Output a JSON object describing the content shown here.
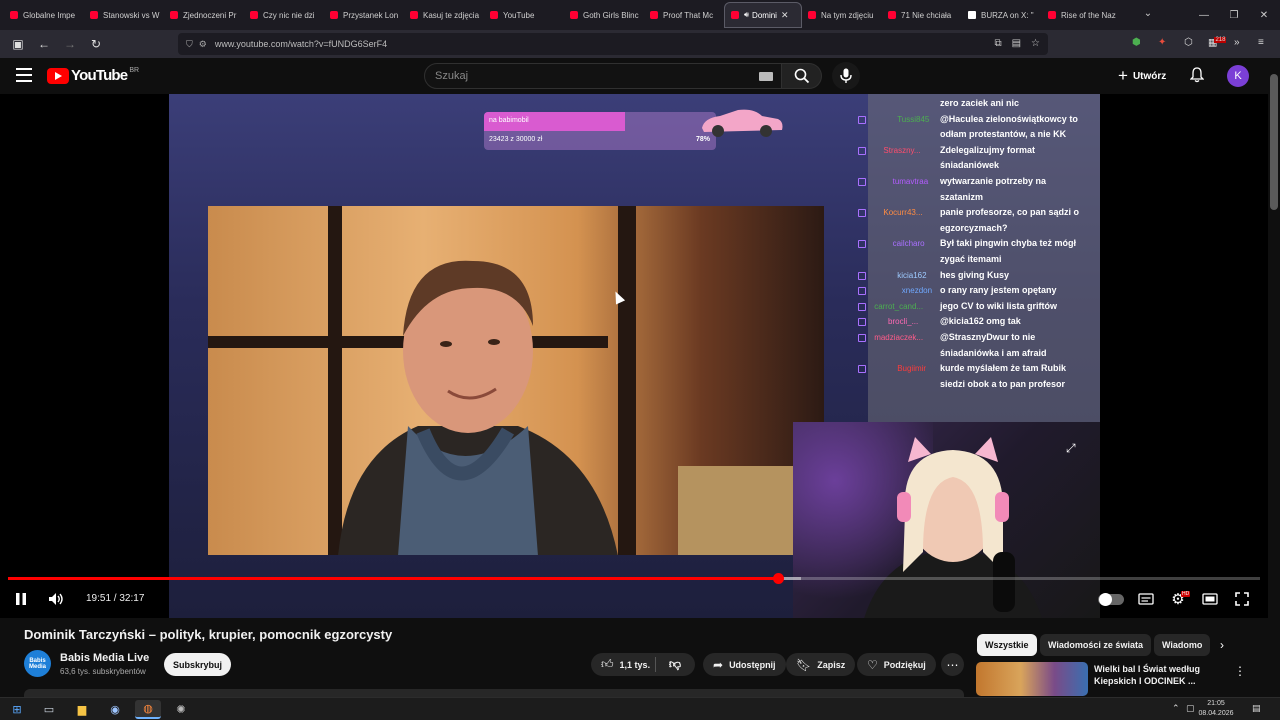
{
  "browser": {
    "tabs": [
      {
        "label": "Globalne Impe",
        "favicon": "youtube-icon"
      },
      {
        "label": "Stanowski vs W",
        "favicon": "youtube-icon"
      },
      {
        "label": "Zjednoczeni Pr",
        "favicon": "youtube-icon"
      },
      {
        "label": "Czy nic nie dzi",
        "favicon": "youtube-icon"
      },
      {
        "label": "Przystanek Lon",
        "favicon": "youtube-icon"
      },
      {
        "label": "Kasuj te zdjęcia",
        "favicon": "youtube-icon"
      },
      {
        "label": "YouTube",
        "favicon": "youtube-icon"
      },
      {
        "label": "Goth Girls Blinc",
        "favicon": "youtube-icon"
      },
      {
        "label": "Proof That Mc",
        "favicon": "youtube-icon"
      },
      {
        "label": "Domini",
        "favicon": "youtube-icon",
        "active": true
      },
      {
        "label": "Na tym zdjęciu",
        "favicon": "youtube-icon"
      },
      {
        "label": "71 Nie chciała",
        "favicon": "youtube-icon"
      },
      {
        "label": "BURZA on X: \"",
        "favicon": "x-icon"
      },
      {
        "label": "Rise of the Naz",
        "favicon": "youtube-icon"
      }
    ],
    "url": "www.youtube.com/watch?v=fUNDG6SerF4",
    "extension_badge": "218"
  },
  "youtube": {
    "logo_text": "YouTube",
    "country_code": "BR",
    "search_placeholder": "Szukaj",
    "create_label": "Utwórz",
    "avatar_letter": "K"
  },
  "video": {
    "title": "Dominik Tarczyński – polityk, krupier, pomocnik egzorcysty",
    "time_current": "19:51",
    "time_total": "32:17",
    "time_display": "19:51 / 32:17",
    "progress_fraction": 0.615,
    "buffer_fraction": 0.633,
    "overlay": {
      "goal_title": "na babimobil",
      "goal_amount": "23423 z 30000 zł",
      "goal_percent": "78%",
      "goal_fraction": 0.78
    },
    "chat": [
      {
        "user": "",
        "text": "zero zaciek ani nic",
        "color": "#4caf50"
      },
      {
        "user": "Tussi845",
        "text": "@Haculea zielonoświątkowcy to",
        "color": "#4caf50"
      },
      {
        "user": "",
        "text": "odłam protestantów, a nie KK",
        "color": "#4caf50"
      },
      {
        "user": "Straszny...",
        "text": "Zdelegalizujmy format",
        "color": "#ff4d6d"
      },
      {
        "user": "",
        "text": "śniadaniówek",
        "color": "#ff4d6d"
      },
      {
        "user": "tumavtraa",
        "text": "wytwarzanie potrzeby na",
        "color": "#b45cff"
      },
      {
        "user": "",
        "text": "szatanizm",
        "color": "#b45cff"
      },
      {
        "user": "Kocurr43...",
        "text": "panie profesorze, co pan sądzi o",
        "color": "#ff8c42"
      },
      {
        "user": "",
        "text": "egzorcyzmach?",
        "color": "#ff8c42"
      },
      {
        "user": "cailcharo",
        "text": "Był taki pingwin chyba też mógł",
        "color": "#a970ff"
      },
      {
        "user": "",
        "text": "zygać itemami",
        "color": "#a970ff"
      },
      {
        "user": "kicia162",
        "text": "hes giving Kusy",
        "color": "#9ecbff"
      },
      {
        "user": "xnezdon",
        "text": "o rany rany jestem opętany",
        "color": "#6fa8ff"
      },
      {
        "user": "carrot_cand...",
        "text": "jego CV to wiki lista griftów",
        "color": "#4caf50"
      },
      {
        "user": "brocli_...",
        "text": "@kicia162 omg tak",
        "color": "#ff69b4"
      },
      {
        "user": "madziaczek...",
        "text": "@StrasznyDwur to nie",
        "color": "#ff5c8a"
      },
      {
        "user": "",
        "text": "śniadaniówka i am afraid",
        "color": "#ff5c8a"
      },
      {
        "user": "Bugiimir",
        "text": "kurde myślałem że tam Rubik",
        "color": "#ff3b3b"
      },
      {
        "user": "",
        "text": "siedzi obok a to pan profesor",
        "color": "#ff3b3b"
      }
    ]
  },
  "channel": {
    "avatar_text": "Babis Media",
    "name": "Babis Media Live",
    "subscribers": "63,6 tys. subskrybentów",
    "subscribe_label": "Subskrybuj"
  },
  "actions": {
    "like_count": "1,1 tys.",
    "share_label": "Udostępnij",
    "save_label": "Zapisz",
    "thanks_label": "Podziękuj"
  },
  "chips": [
    "Wszystkie",
    "Wiadomości ze świata",
    "Wiadomo"
  ],
  "recommendation": {
    "title": "Wielki bal I Świat według Kiepskich I ODCINEK ..."
  },
  "taskbar": {
    "time": "21:05",
    "date": "08.04.2026"
  },
  "colors": {
    "accent": "#ff0000",
    "goal_pink": "#d95bd0"
  }
}
